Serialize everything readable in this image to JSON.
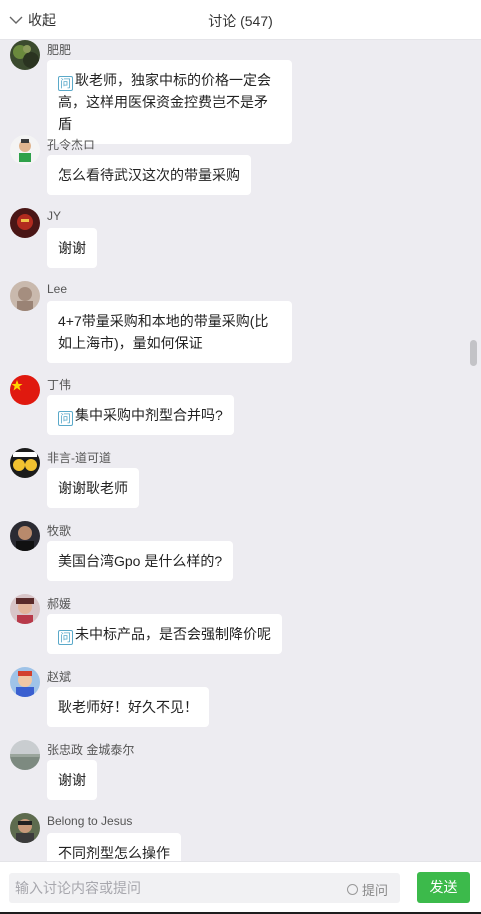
{
  "header": {
    "collapse_label": "收起",
    "title": "讨论 (547)"
  },
  "messages": [
    {
      "sender": "肥肥",
      "text": "耿老师，独家中标的价格一定会高，这样用医保资金控费岂不是矛盾",
      "question": true
    },
    {
      "sender": "孔令杰ロ",
      "text": "怎么看待武汉这次的带量采购",
      "question": false
    },
    {
      "sender": "JY",
      "text": "谢谢",
      "question": false
    },
    {
      "sender": "Lee",
      "text": "4+7带量采购和本地的带量采购(比如上海市)，量如何保证",
      "question": false
    },
    {
      "sender": "丁伟",
      "text": "集中采购中剂型合并吗?",
      "question": true
    },
    {
      "sender": "非言-道可道",
      "text": "谢谢耿老师",
      "question": false
    },
    {
      "sender": "牧歌",
      "text": "美国台湾Gpo 是什么样的?",
      "question": false
    },
    {
      "sender": "郝媛",
      "text": "未中标产品，是否会强制降价呢",
      "question": true
    },
    {
      "sender": "赵斌",
      "text": "耿老师好！好久不见！",
      "question": false
    },
    {
      "sender": "张忠政 金城泰尔",
      "text": "谢谢",
      "question": false
    },
    {
      "sender": "Belong to Jesus",
      "text": "不同剂型怎么操作",
      "question": false
    }
  ],
  "question_tag": "问",
  "footer": {
    "input_placeholder": "输入讨论内容或提问",
    "ask_label": "提问",
    "send_label": "发送"
  },
  "colors": {
    "send_button": "#3cba4b",
    "background": "#edecf1",
    "question_tag": "#5aa9c9"
  }
}
